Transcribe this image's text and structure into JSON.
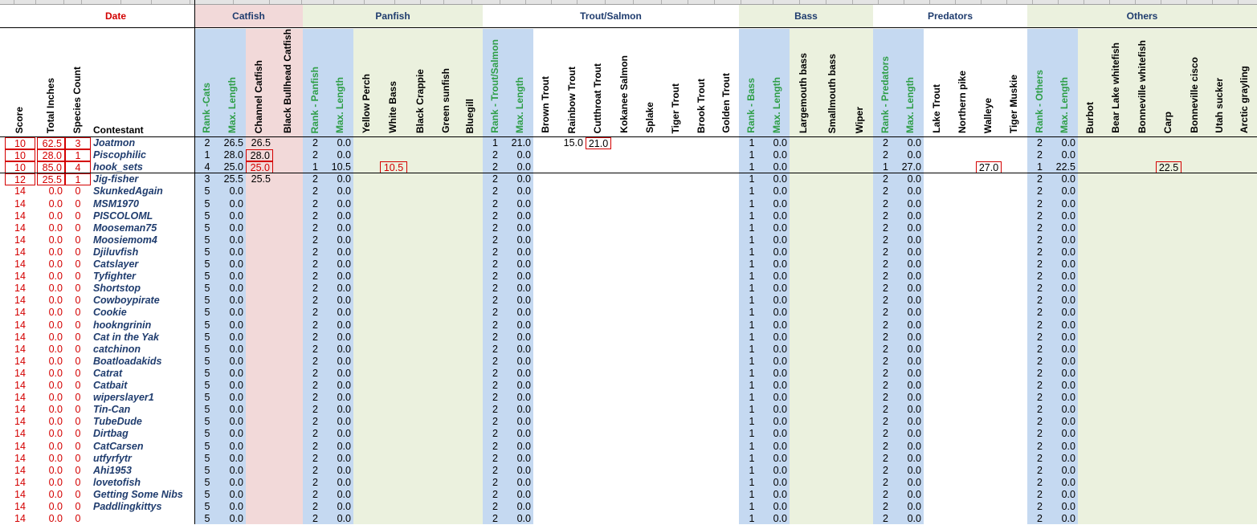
{
  "colors": {
    "catfish_bg": "#f2d9d9",
    "green_bg": "#ebf1de",
    "rank_bg": "#c5d9f1",
    "red": "#d40000",
    "name_text": "#1f3c6e",
    "rank_label": "#2e9e47"
  },
  "groups": {
    "date": "Date",
    "catfish": "Catfish",
    "panfish": "Panfish",
    "trout": "Trout/Salmon",
    "bass": "Bass",
    "predators": "Predators",
    "others": "Others"
  },
  "headers": {
    "score": "Score",
    "total_inches": "Total Inches",
    "species_count": "Species Count",
    "contestant": "Contestant",
    "rank_cats": "Rank -Cats",
    "max_length": "Max. Length",
    "channel_catfish": "Channel Catfish",
    "black_bullhead": "Black Bullhead Catfish",
    "rank_panfish": "Rank - Panfish",
    "yellow_perch": "Yellow Perch",
    "white_bass": "White Bass",
    "black_crappie": "Black Crappie",
    "green_sunfish": "Green sunfish",
    "bluegill": "Bluegill",
    "rank_trout": "Rank - Trout/Salmon",
    "brown_trout": "Brown Trout",
    "rainbow_trout": "Rainbow Trout",
    "cutthroat_trout": "Cutthroat Trout",
    "kokanee": "Kokanee Salmon",
    "splake": "Splake",
    "tiger_trout": "Tiger Trout",
    "brook_trout": "Brook Trout",
    "golden_trout": "Golden Trout",
    "rank_bass": "Rank - Bass",
    "largemouth": "Largemouth bass",
    "smallmouth": "Smallmouth bass",
    "wiper": "Wiper",
    "rank_predators": "Rank - Predators",
    "lake_trout": "Lake Trout",
    "northern_pike": "Northern pike",
    "walleye": "Walleye",
    "tiger_muskie": "Tiger Muskie",
    "rank_others": "Rank - Others",
    "burbot": "Burbot",
    "bear_lake": "Bear Lake whitefish",
    "bonneville_whitefish": "Bonneville whitefish",
    "carp": "Carp",
    "bonneville_cisco": "Bonneville cisco",
    "utah_sucker": "Utah sucker",
    "arctic_grayling": "Arctic grayling"
  },
  "rows": [
    {
      "score": "10",
      "inches": "62.5",
      "species": "3",
      "name": "Joatmon",
      "cats_rank": "2",
      "cats_max": "26.5",
      "channel": "26.5",
      "pan_rank": "2",
      "pan_max": "0.0",
      "trout_rank": "1",
      "trout_max": "21.0",
      "rainbow": "15.0",
      "cutthroat": "21.0",
      "bass_rank": "1",
      "bass_max": "0.0",
      "pred_rank": "2",
      "pred_max": "0.0",
      "oth_rank": "2",
      "oth_max": "0.0"
    },
    {
      "score": "10",
      "inches": "28.0",
      "species": "1",
      "name": "Piscophilic",
      "cats_rank": "1",
      "cats_max": "28.0",
      "channel": "28.0",
      "pan_rank": "2",
      "pan_max": "0.0",
      "trout_rank": "2",
      "trout_max": "0.0",
      "bass_rank": "1",
      "bass_max": "0.0",
      "pred_rank": "2",
      "pred_max": "0.0",
      "oth_rank": "2",
      "oth_max": "0.0"
    },
    {
      "score": "10",
      "inches": "85.0",
      "species": "4",
      "name": "hook_sets",
      "cats_rank": "4",
      "cats_max": "25.0",
      "channel": "25.0",
      "pan_rank": "1",
      "pan_max": "10.5",
      "white_bass": "10.5",
      "trout_rank": "2",
      "trout_max": "0.0",
      "bass_rank": "1",
      "bass_max": "0.0",
      "pred_rank": "1",
      "pred_max": "27.0",
      "walleye": "27.0",
      "oth_rank": "1",
      "oth_max": "22.5",
      "carp": "22.5"
    },
    {
      "score": "12",
      "inches": "25.5",
      "species": "1",
      "name": "Jig-fisher",
      "cats_rank": "3",
      "cats_max": "25.5",
      "channel": "25.5",
      "pan_rank": "2",
      "pan_max": "0.0",
      "trout_rank": "2",
      "trout_max": "0.0",
      "bass_rank": "1",
      "bass_max": "0.0",
      "pred_rank": "2",
      "pred_max": "0.0",
      "oth_rank": "2",
      "oth_max": "0.0"
    },
    {
      "score": "14",
      "inches": "0.0",
      "species": "0",
      "name": "SkunkedAgain",
      "cats_rank": "5",
      "cats_max": "0.0",
      "pan_rank": "2",
      "pan_max": "0.0",
      "trout_rank": "2",
      "trout_max": "0.0",
      "bass_rank": "1",
      "bass_max": "0.0",
      "pred_rank": "2",
      "pred_max": "0.0",
      "oth_rank": "2",
      "oth_max": "0.0"
    },
    {
      "score": "14",
      "inches": "0.0",
      "species": "0",
      "name": "MSM1970",
      "cats_rank": "5",
      "cats_max": "0.0",
      "pan_rank": "2",
      "pan_max": "0.0",
      "trout_rank": "2",
      "trout_max": "0.0",
      "bass_rank": "1",
      "bass_max": "0.0",
      "pred_rank": "2",
      "pred_max": "0.0",
      "oth_rank": "2",
      "oth_max": "0.0"
    },
    {
      "score": "14",
      "inches": "0.0",
      "species": "0",
      "name": "PISCOLOML",
      "cats_rank": "5",
      "cats_max": "0.0",
      "pan_rank": "2",
      "pan_max": "0.0",
      "trout_rank": "2",
      "trout_max": "0.0",
      "bass_rank": "1",
      "bass_max": "0.0",
      "pred_rank": "2",
      "pred_max": "0.0",
      "oth_rank": "2",
      "oth_max": "0.0"
    },
    {
      "score": "14",
      "inches": "0.0",
      "species": "0",
      "name": "Mooseman75",
      "cats_rank": "5",
      "cats_max": "0.0",
      "pan_rank": "2",
      "pan_max": "0.0",
      "trout_rank": "2",
      "trout_max": "0.0",
      "bass_rank": "1",
      "bass_max": "0.0",
      "pred_rank": "2",
      "pred_max": "0.0",
      "oth_rank": "2",
      "oth_max": "0.0"
    },
    {
      "score": "14",
      "inches": "0.0",
      "species": "0",
      "name": "Moosiemom4",
      "cats_rank": "5",
      "cats_max": "0.0",
      "pan_rank": "2",
      "pan_max": "0.0",
      "trout_rank": "2",
      "trout_max": "0.0",
      "bass_rank": "1",
      "bass_max": "0.0",
      "pred_rank": "2",
      "pred_max": "0.0",
      "oth_rank": "2",
      "oth_max": "0.0"
    },
    {
      "score": "14",
      "inches": "0.0",
      "species": "0",
      "name": "Djiluvfish",
      "cats_rank": "5",
      "cats_max": "0.0",
      "pan_rank": "2",
      "pan_max": "0.0",
      "trout_rank": "2",
      "trout_max": "0.0",
      "bass_rank": "1",
      "bass_max": "0.0",
      "pred_rank": "2",
      "pred_max": "0.0",
      "oth_rank": "2",
      "oth_max": "0.0"
    },
    {
      "score": "14",
      "inches": "0.0",
      "species": "0",
      "name": "Catslayer",
      "cats_rank": "5",
      "cats_max": "0.0",
      "pan_rank": "2",
      "pan_max": "0.0",
      "trout_rank": "2",
      "trout_max": "0.0",
      "bass_rank": "1",
      "bass_max": "0.0",
      "pred_rank": "2",
      "pred_max": "0.0",
      "oth_rank": "2",
      "oth_max": "0.0"
    },
    {
      "score": "14",
      "inches": "0.0",
      "species": "0",
      "name": "Tyfighter",
      "cats_rank": "5",
      "cats_max": "0.0",
      "pan_rank": "2",
      "pan_max": "0.0",
      "trout_rank": "2",
      "trout_max": "0.0",
      "bass_rank": "1",
      "bass_max": "0.0",
      "pred_rank": "2",
      "pred_max": "0.0",
      "oth_rank": "2",
      "oth_max": "0.0"
    },
    {
      "score": "14",
      "inches": "0.0",
      "species": "0",
      "name": "Shortstop",
      "cats_rank": "5",
      "cats_max": "0.0",
      "pan_rank": "2",
      "pan_max": "0.0",
      "trout_rank": "2",
      "trout_max": "0.0",
      "bass_rank": "1",
      "bass_max": "0.0",
      "pred_rank": "2",
      "pred_max": "0.0",
      "oth_rank": "2",
      "oth_max": "0.0"
    },
    {
      "score": "14",
      "inches": "0.0",
      "species": "0",
      "name": "Cowboypirate",
      "cats_rank": "5",
      "cats_max": "0.0",
      "pan_rank": "2",
      "pan_max": "0.0",
      "trout_rank": "2",
      "trout_max": "0.0",
      "bass_rank": "1",
      "bass_max": "0.0",
      "pred_rank": "2",
      "pred_max": "0.0",
      "oth_rank": "2",
      "oth_max": "0.0"
    },
    {
      "score": "14",
      "inches": "0.0",
      "species": "0",
      "name": "Cookie",
      "cats_rank": "5",
      "cats_max": "0.0",
      "pan_rank": "2",
      "pan_max": "0.0",
      "trout_rank": "2",
      "trout_max": "0.0",
      "bass_rank": "1",
      "bass_max": "0.0",
      "pred_rank": "2",
      "pred_max": "0.0",
      "oth_rank": "2",
      "oth_max": "0.0"
    },
    {
      "score": "14",
      "inches": "0.0",
      "species": "0",
      "name": "hookngrinin",
      "cats_rank": "5",
      "cats_max": "0.0",
      "pan_rank": "2",
      "pan_max": "0.0",
      "trout_rank": "2",
      "trout_max": "0.0",
      "bass_rank": "1",
      "bass_max": "0.0",
      "pred_rank": "2",
      "pred_max": "0.0",
      "oth_rank": "2",
      "oth_max": "0.0"
    },
    {
      "score": "14",
      "inches": "0.0",
      "species": "0",
      "name": "Cat in the Yak",
      "cats_rank": "5",
      "cats_max": "0.0",
      "pan_rank": "2",
      "pan_max": "0.0",
      "trout_rank": "2",
      "trout_max": "0.0",
      "bass_rank": "1",
      "bass_max": "0.0",
      "pred_rank": "2",
      "pred_max": "0.0",
      "oth_rank": "2",
      "oth_max": "0.0"
    },
    {
      "score": "14",
      "inches": "0.0",
      "species": "0",
      "name": "catchinon",
      "cats_rank": "5",
      "cats_max": "0.0",
      "pan_rank": "2",
      "pan_max": "0.0",
      "trout_rank": "2",
      "trout_max": "0.0",
      "bass_rank": "1",
      "bass_max": "0.0",
      "pred_rank": "2",
      "pred_max": "0.0",
      "oth_rank": "2",
      "oth_max": "0.0"
    },
    {
      "score": "14",
      "inches": "0.0",
      "species": "0",
      "name": "Boatloadakids",
      "cats_rank": "5",
      "cats_max": "0.0",
      "pan_rank": "2",
      "pan_max": "0.0",
      "trout_rank": "2",
      "trout_max": "0.0",
      "bass_rank": "1",
      "bass_max": "0.0",
      "pred_rank": "2",
      "pred_max": "0.0",
      "oth_rank": "2",
      "oth_max": "0.0"
    },
    {
      "score": "14",
      "inches": "0.0",
      "species": "0",
      "name": "Catrat",
      "cats_rank": "5",
      "cats_max": "0.0",
      "pan_rank": "2",
      "pan_max": "0.0",
      "trout_rank": "2",
      "trout_max": "0.0",
      "bass_rank": "1",
      "bass_max": "0.0",
      "pred_rank": "2",
      "pred_max": "0.0",
      "oth_rank": "2",
      "oth_max": "0.0"
    },
    {
      "score": "14",
      "inches": "0.0",
      "species": "0",
      "name": "Catbait",
      "cats_rank": "5",
      "cats_max": "0.0",
      "pan_rank": "2",
      "pan_max": "0.0",
      "trout_rank": "2",
      "trout_max": "0.0",
      "bass_rank": "1",
      "bass_max": "0.0",
      "pred_rank": "2",
      "pred_max": "0.0",
      "oth_rank": "2",
      "oth_max": "0.0"
    },
    {
      "score": "14",
      "inches": "0.0",
      "species": "0",
      "name": "wiperslayer1",
      "cats_rank": "5",
      "cats_max": "0.0",
      "pan_rank": "2",
      "pan_max": "0.0",
      "trout_rank": "2",
      "trout_max": "0.0",
      "bass_rank": "1",
      "bass_max": "0.0",
      "pred_rank": "2",
      "pred_max": "0.0",
      "oth_rank": "2",
      "oth_max": "0.0"
    },
    {
      "score": "14",
      "inches": "0.0",
      "species": "0",
      "name": "Tin-Can",
      "cats_rank": "5",
      "cats_max": "0.0",
      "pan_rank": "2",
      "pan_max": "0.0",
      "trout_rank": "2",
      "trout_max": "0.0",
      "bass_rank": "1",
      "bass_max": "0.0",
      "pred_rank": "2",
      "pred_max": "0.0",
      "oth_rank": "2",
      "oth_max": "0.0"
    },
    {
      "score": "14",
      "inches": "0.0",
      "species": "0",
      "name": "TubeDude",
      "cats_rank": "5",
      "cats_max": "0.0",
      "pan_rank": "2",
      "pan_max": "0.0",
      "trout_rank": "2",
      "trout_max": "0.0",
      "bass_rank": "1",
      "bass_max": "0.0",
      "pred_rank": "2",
      "pred_max": "0.0",
      "oth_rank": "2",
      "oth_max": "0.0"
    },
    {
      "score": "14",
      "inches": "0.0",
      "species": "0",
      "name": "Dirtbag",
      "cats_rank": "5",
      "cats_max": "0.0",
      "pan_rank": "2",
      "pan_max": "0.0",
      "trout_rank": "2",
      "trout_max": "0.0",
      "bass_rank": "1",
      "bass_max": "0.0",
      "pred_rank": "2",
      "pred_max": "0.0",
      "oth_rank": "2",
      "oth_max": "0.0"
    },
    {
      "score": "14",
      "inches": "0.0",
      "species": "0",
      "name": "CatCarsen",
      "cats_rank": "5",
      "cats_max": "0.0",
      "pan_rank": "2",
      "pan_max": "0.0",
      "trout_rank": "2",
      "trout_max": "0.0",
      "bass_rank": "1",
      "bass_max": "0.0",
      "pred_rank": "2",
      "pred_max": "0.0",
      "oth_rank": "2",
      "oth_max": "0.0"
    },
    {
      "score": "14",
      "inches": "0.0",
      "species": "0",
      "name": "utfyrfytr",
      "cats_rank": "5",
      "cats_max": "0.0",
      "pan_rank": "2",
      "pan_max": "0.0",
      "trout_rank": "2",
      "trout_max": "0.0",
      "bass_rank": "1",
      "bass_max": "0.0",
      "pred_rank": "2",
      "pred_max": "0.0",
      "oth_rank": "2",
      "oth_max": "0.0"
    },
    {
      "score": "14",
      "inches": "0.0",
      "species": "0",
      "name": "Ahi1953",
      "cats_rank": "5",
      "cats_max": "0.0",
      "pan_rank": "2",
      "pan_max": "0.0",
      "trout_rank": "2",
      "trout_max": "0.0",
      "bass_rank": "1",
      "bass_max": "0.0",
      "pred_rank": "2",
      "pred_max": "0.0",
      "oth_rank": "2",
      "oth_max": "0.0"
    },
    {
      "score": "14",
      "inches": "0.0",
      "species": "0",
      "name": "lovetofish",
      "cats_rank": "5",
      "cats_max": "0.0",
      "pan_rank": "2",
      "pan_max": "0.0",
      "trout_rank": "2",
      "trout_max": "0.0",
      "bass_rank": "1",
      "bass_max": "0.0",
      "pred_rank": "2",
      "pred_max": "0.0",
      "oth_rank": "2",
      "oth_max": "0.0"
    },
    {
      "score": "14",
      "inches": "0.0",
      "species": "0",
      "name": "Getting Some Nibs",
      "cats_rank": "5",
      "cats_max": "0.0",
      "pan_rank": "2",
      "pan_max": "0.0",
      "trout_rank": "2",
      "trout_max": "0.0",
      "bass_rank": "1",
      "bass_max": "0.0",
      "pred_rank": "2",
      "pred_max": "0.0",
      "oth_rank": "2",
      "oth_max": "0.0"
    },
    {
      "score": "14",
      "inches": "0.0",
      "species": "0",
      "name": "Paddlingkittys",
      "cats_rank": "5",
      "cats_max": "0.0",
      "pan_rank": "2",
      "pan_max": "0.0",
      "trout_rank": "2",
      "trout_max": "0.0",
      "bass_rank": "1",
      "bass_max": "0.0",
      "pred_rank": "2",
      "pred_max": "0.0",
      "oth_rank": "2",
      "oth_max": "0.0"
    },
    {
      "score": "14",
      "inches": "0.0",
      "species": "0",
      "name": "",
      "cats_rank": "5",
      "cats_max": "0.0",
      "pan_rank": "2",
      "pan_max": "0.0",
      "trout_rank": "2",
      "trout_max": "0.0",
      "bass_rank": "1",
      "bass_max": "0.0",
      "pred_rank": "2",
      "pred_max": "0.0",
      "oth_rank": "2",
      "oth_max": "0.0"
    }
  ]
}
